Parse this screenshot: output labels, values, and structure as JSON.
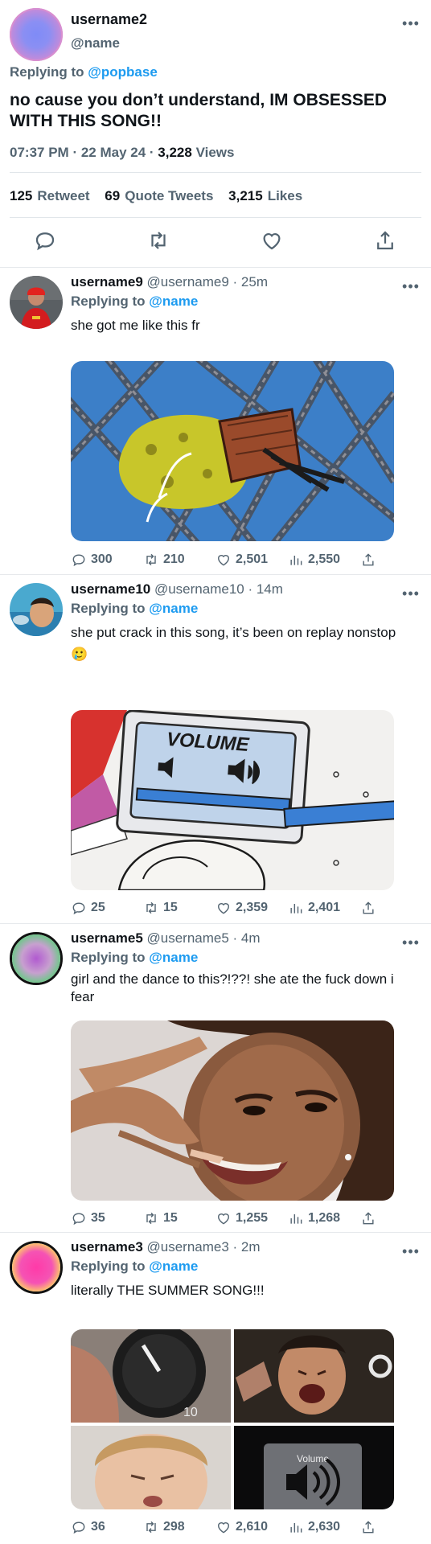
{
  "main_tweet": {
    "display_name": "username2",
    "handle": "@name",
    "replying_prefix": "Replying to",
    "replying_to": "@popbase",
    "text": "no cause you don’t understand, IM OBSESSED WITH THIS SONG!!",
    "time": "07:37 PM",
    "date": "22 May 24",
    "views_count": "3,228",
    "views_label": "Views",
    "retweets_count": "125",
    "retweets_label": "Retweet",
    "quotes_count": "69",
    "quotes_label": "Quote Tweets",
    "likes_count": "3,215",
    "likes_label": "Likes",
    "more": "•••"
  },
  "replies": [
    {
      "display_name": "username9",
      "handle_time": "@username9 · 25m",
      "replying_prefix": "Replying to",
      "replying_to": "@name",
      "text": "she got me like this fr",
      "replies": "300",
      "retweets": "210",
      "likes": "2,501",
      "views": "2,550"
    },
    {
      "display_name": "username10",
      "handle_time": "@username10 · 14m",
      "replying_prefix": "Replying to",
      "replying_to": "@name",
      "text": "she put crack in this song, it’s been on replay nonstop 🥲",
      "replies": "25",
      "retweets": "15",
      "likes": "2,359",
      "views": "2,401",
      "media_text": "VOLUME"
    },
    {
      "display_name": "username5",
      "handle_time": "@username5 · 4m",
      "replying_prefix": "Replying to",
      "replying_to": "@name",
      "text": "girl and the dance to this?!??! she ate the fuck down i fear",
      "replies": "35",
      "retweets": "15",
      "likes": "1,255",
      "views": "1,268"
    },
    {
      "display_name": "username3",
      "handle_time": "@username3 · 2m",
      "replying_prefix": "Replying to",
      "replying_to": "@name",
      "text": "literally THE SUMMER SONG!!!",
      "replies": "36",
      "retweets": "298",
      "likes": "2,610",
      "views": "2,630",
      "media_knob_text": "10",
      "media_volume_text": "Volume"
    }
  ],
  "colors": {
    "accent": "#1d9bf0",
    "muted": "#536471",
    "text": "#0f1419"
  }
}
